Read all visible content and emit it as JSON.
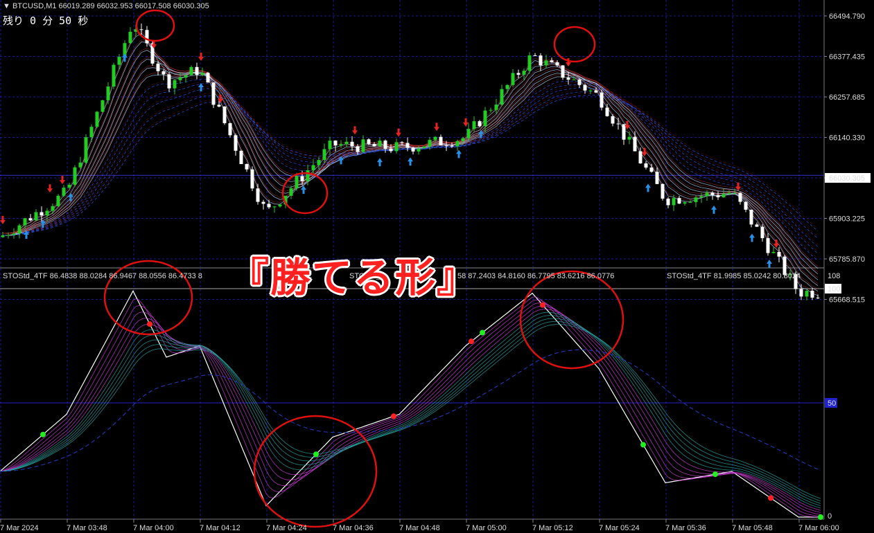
{
  "header": {
    "symbol_line": "▼ BTCUSD,M1  66019.289 66032.953 66017.508 66030.305",
    "remaining": "残り 0 分 50 秒"
  },
  "indicator": {
    "label_left": "STOStd_4TF 86.4838 88.0284 86.9467 88.0556 86.4733 8",
    "label_mid": "STOStd_4",
    "label_mid2": "58 87.2403 84.8160 86.7795 83.6216 86.0776",
    "label_right": "STOStd_4TF 81.9985 85.0242 80.8024"
  },
  "overlay_text": "『勝てる形』",
  "colors": {
    "bg": "#000000",
    "bull": "#22cc22",
    "bear": "#ffffff",
    "grid": "#1a1a99",
    "up_arrow": "#2a8fe6",
    "down_arrow": "#e62222",
    "circle": "#e01010"
  },
  "chart_data": [
    {
      "type": "line",
      "title": "BTCUSD,M1",
      "y_ticks": [
        "66494.790",
        "66377.435",
        "66257.685",
        "66140.330",
        "66030.305",
        "65903.225",
        "65785.870",
        "65668.515"
      ],
      "current_price": "66030.305",
      "approx_close_path": [
        {
          "t": "03:36",
          "y": 65850
        },
        {
          "t": "03:48",
          "y": 65980
        },
        {
          "t": "04:00",
          "y": 66480
        },
        {
          "t": "04:06",
          "y": 66300
        },
        {
          "t": "04:12",
          "y": 66340
        },
        {
          "t": "04:24",
          "y": 65920
        },
        {
          "t": "04:36",
          "y": 66120
        },
        {
          "t": "04:48",
          "y": 66110
        },
        {
          "t": "05:00",
          "y": 66140
        },
        {
          "t": "05:12",
          "y": 66380
        },
        {
          "t": "05:24",
          "y": 66260
        },
        {
          "t": "05:36",
          "y": 65960
        },
        {
          "t": "05:48",
          "y": 65980
        },
        {
          "t": "06:00",
          "y": 65690
        }
      ]
    },
    {
      "type": "line",
      "title": "STOStd_4TF",
      "y_ticks": [
        "108",
        "100",
        "50",
        "0"
      ],
      "x_ticks": [
        "7 Mar 2024",
        "7 Mar 03:48",
        "7 Mar 04:00",
        "7 Mar 04:12",
        "7 Mar 04:24",
        "7 Mar 04:36",
        "7 Mar 04:48",
        "7 Mar 05:00",
        "7 Mar 05:12",
        "7 Mar 05:24",
        "7 Mar 05:36",
        "7 Mar 05:48",
        "7 Mar 06:00"
      ],
      "approx_main_line": [
        {
          "t": "03:36",
          "y": 20
        },
        {
          "t": "03:48",
          "y": 45
        },
        {
          "t": "04:00",
          "y": 99
        },
        {
          "t": "04:06",
          "y": 70
        },
        {
          "t": "04:12",
          "y": 75
        },
        {
          "t": "04:24",
          "y": 5
        },
        {
          "t": "04:36",
          "y": 35
        },
        {
          "t": "04:48",
          "y": 45
        },
        {
          "t": "05:00",
          "y": 75
        },
        {
          "t": "05:12",
          "y": 98
        },
        {
          "t": "05:24",
          "y": 65
        },
        {
          "t": "05:36",
          "y": 15
        },
        {
          "t": "05:48",
          "y": 20
        },
        {
          "t": "06:00",
          "y": 0
        }
      ]
    }
  ]
}
